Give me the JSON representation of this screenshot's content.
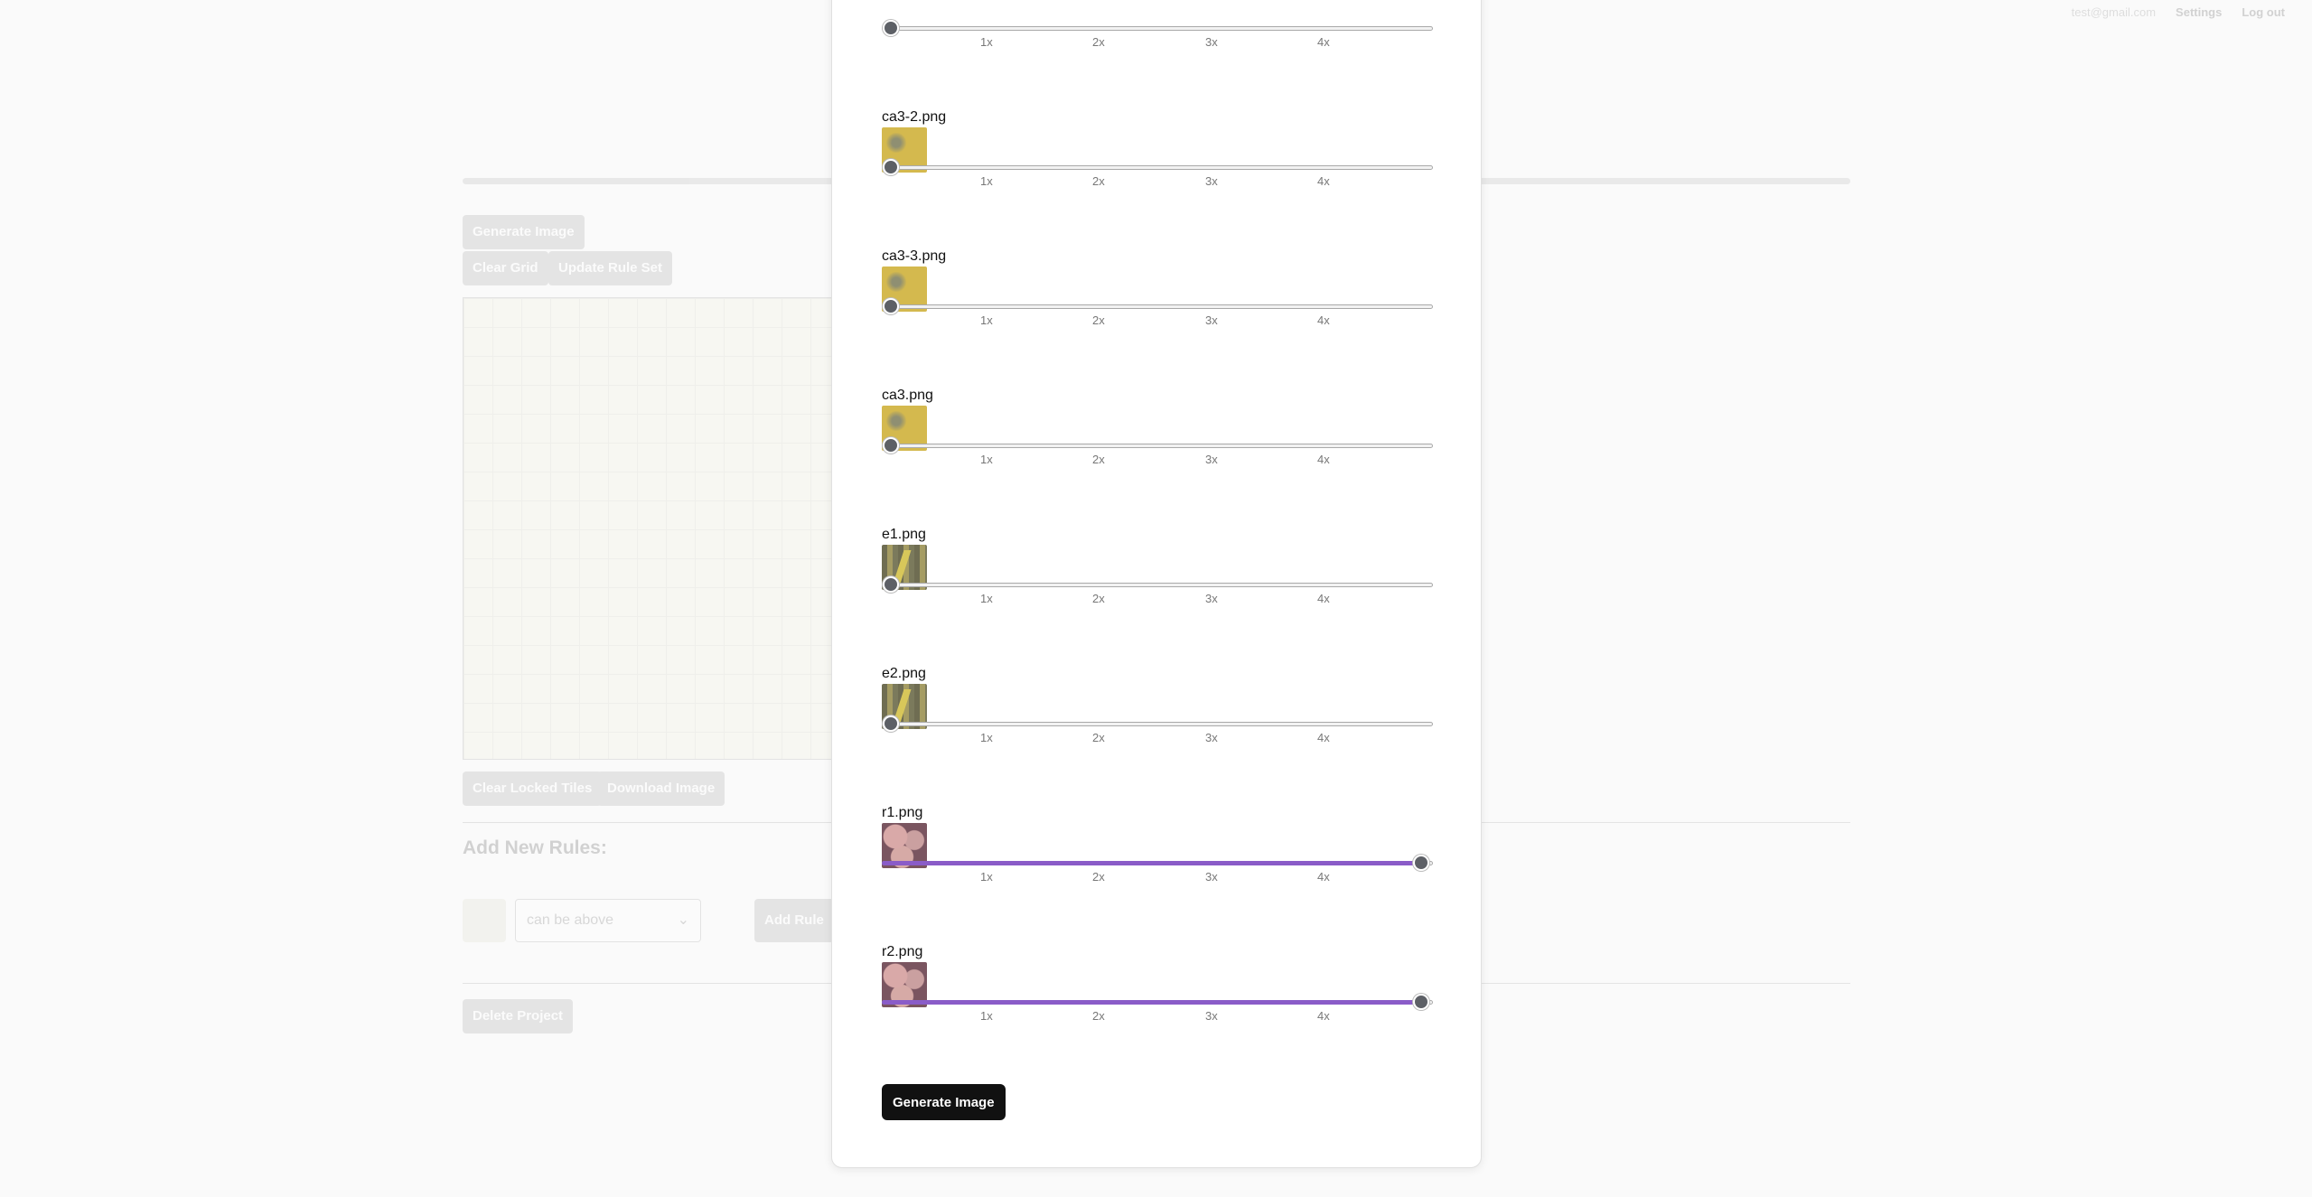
{
  "nav": {
    "email": "test@gmail.com",
    "settings": "Settings",
    "logout": "Log out"
  },
  "background": {
    "generate_image": "Generate Image",
    "clear_grid": "Clear Grid",
    "update_rule_set": "Update Rule Set",
    "clear_locked_tiles": "Clear Locked Tiles",
    "download_image": "Download Image",
    "add_new_rules_heading": "Add New Rules:",
    "relation_select": "can be above",
    "add_rule": "Add Rule",
    "delete_project": "Delete Project"
  },
  "modal": {
    "tick_labels": [
      "1x",
      "2x",
      "3x",
      "4x"
    ],
    "tiles": [
      {
        "name": "",
        "thumb": "sand-tile-icon",
        "weight": 0
      },
      {
        "name": "ca3-2.png",
        "thumb": "sand-tile-icon",
        "weight": 0
      },
      {
        "name": "ca3-3.png",
        "thumb": "sand-tile-icon",
        "weight": 0
      },
      {
        "name": "ca3.png",
        "thumb": "sand-tile-icon",
        "weight": 0
      },
      {
        "name": "e1.png",
        "thumb": "fence-tile-icon",
        "weight": 0
      },
      {
        "name": "e2.png",
        "thumb": "fence-tile-icon",
        "weight": 0
      },
      {
        "name": "r1.png",
        "thumb": "rock-tile-icon",
        "weight": 1
      },
      {
        "name": "r2.png",
        "thumb": "rock-tile-icon",
        "weight": 1
      }
    ],
    "generate_button": "Generate Image"
  }
}
